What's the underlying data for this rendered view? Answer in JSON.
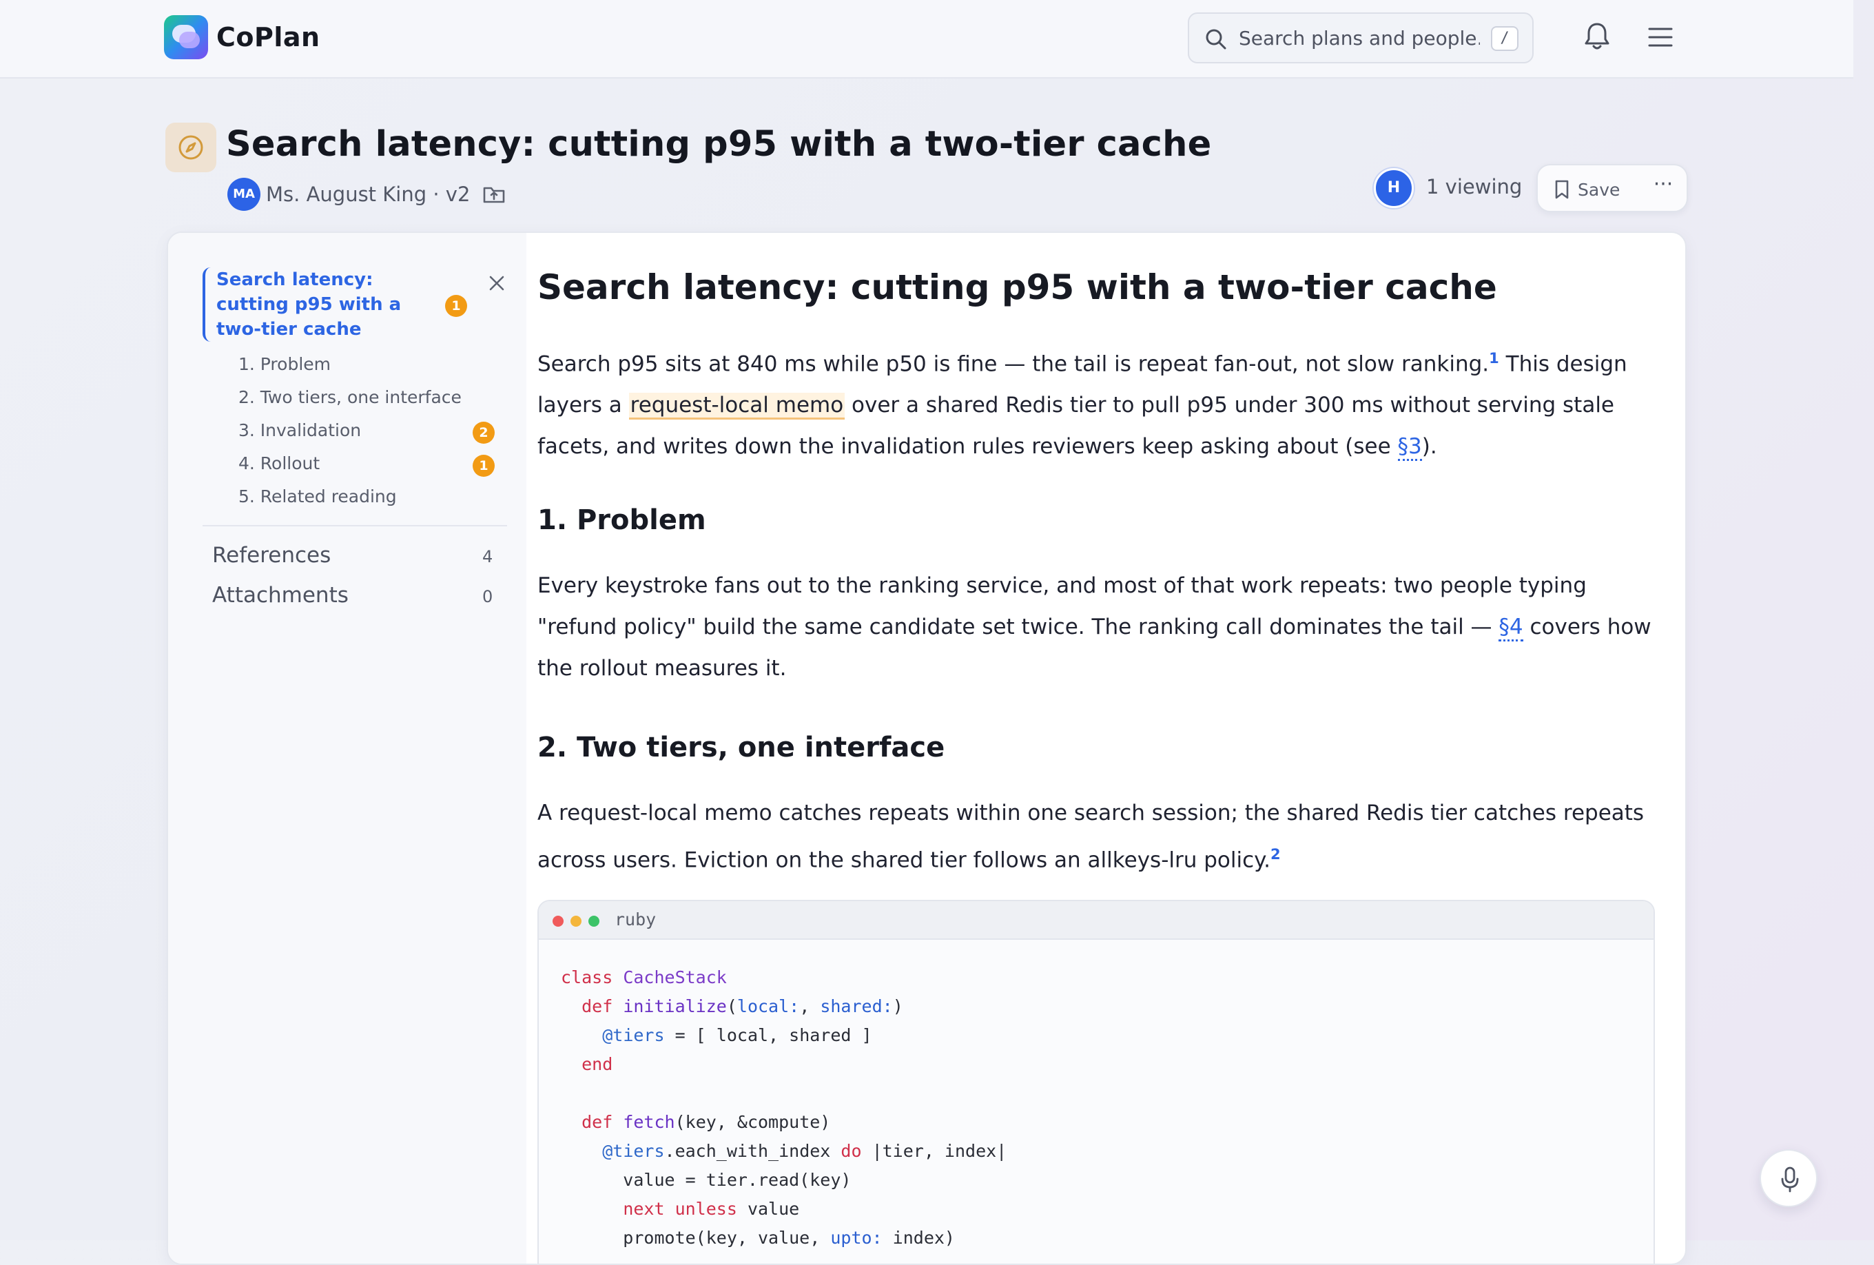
{
  "app": {
    "name": "CoPlan"
  },
  "search": {
    "placeholder": "Search plans and people...",
    "shortcut": "/"
  },
  "plan": {
    "title": "Search latency: cutting p95 with a two-tier cache",
    "author_initials": "MA",
    "author_line": "Ms. August King · v2",
    "viewer_initial": "H",
    "viewing": "1 viewing",
    "save_label": "Save",
    "more_label": "···"
  },
  "sidebar": {
    "current": {
      "label": "Search latency: cutting p95 with a two-tier cache",
      "badge": "1"
    },
    "items": [
      {
        "label": "1. Problem",
        "badge": ""
      },
      {
        "label": "2. Two tiers, one interface",
        "badge": ""
      },
      {
        "label": "3. Invalidation",
        "badge": "2"
      },
      {
        "label": "4. Rollout",
        "badge": "1"
      },
      {
        "label": "5. Related reading",
        "badge": ""
      }
    ],
    "links": [
      {
        "label": "References",
        "count": "4"
      },
      {
        "label": "Attachments",
        "count": "0"
      }
    ]
  },
  "doc": {
    "h1": "Search latency: cutting p95 with a two-tier cache",
    "intro": {
      "t1": "Search p95 sits at 840 ms while p50 is fine — the tail is repeat fan-out, not slow ranking.",
      "fn1": "1",
      "t2": " This design layers a ",
      "mark": "request-local memo",
      "t3": " over a shared Redis tier to pull p95 under 300 ms without serving stale facets, and writes down the invalidation rules reviewers keep asking about (see ",
      "xref": "§3",
      "t4": ")."
    },
    "s1": {
      "heading": "1. Problem",
      "t1": "Every keystroke fans out to the ranking service, and most of that work repeats: two people typing \"refund policy\" build the same candidate set twice. The ranking call dominates the tail — ",
      "xref": "§4",
      "t2": " covers how the rollout measures it."
    },
    "s2": {
      "heading": "2. Two tiers, one interface",
      "t1": "A request-local memo catches repeats within one search session; the shared Redis tier catches repeats across users. Eviction on the shared tier follows an allkeys-lru policy.",
      "fn": "2"
    },
    "code": {
      "lang": "ruby",
      "lines": [
        [
          [
            "kw",
            "class "
          ],
          [
            "cls",
            "CacheStack"
          ]
        ],
        [
          [
            "",
            "  "
          ],
          [
            "kw",
            "def "
          ],
          [
            "fnname",
            "initialize"
          ],
          [
            "",
            "("
          ],
          [
            "sym",
            "local:"
          ],
          [
            "",
            ", "
          ],
          [
            "sym",
            "shared:"
          ],
          [
            "",
            ")"
          ]
        ],
        [
          [
            "",
            "    "
          ],
          [
            "ivar",
            "@tiers"
          ],
          [
            "",
            " = [ local, shared ]"
          ]
        ],
        [
          [
            "",
            "  "
          ],
          [
            "kw",
            "end"
          ]
        ],
        [
          [
            "",
            ""
          ]
        ],
        [
          [
            "",
            "  "
          ],
          [
            "kw",
            "def "
          ],
          [
            "fnname",
            "fetch"
          ],
          [
            "",
            "(key, &compute)"
          ]
        ],
        [
          [
            "",
            "    "
          ],
          [
            "ivar",
            "@tiers"
          ],
          [
            "",
            ".each_with_index "
          ],
          [
            "kw",
            "do"
          ],
          [
            "",
            " |tier, index|"
          ]
        ],
        [
          [
            "",
            "      value = tier.read(key)"
          ]
        ],
        [
          [
            "",
            "      "
          ],
          [
            "kw",
            "next unless"
          ],
          [
            "",
            " value"
          ]
        ],
        [
          [
            "",
            "      promote(key, value, "
          ],
          [
            "sym",
            "upto:"
          ],
          [
            "",
            " index)"
          ]
        ]
      ]
    }
  },
  "colors": {
    "accent": "#2d65e3",
    "badge": "#f29b14",
    "dot_red": "#f05b5b",
    "dot_yellow": "#f4b63c",
    "dot_green": "#3cc368"
  }
}
